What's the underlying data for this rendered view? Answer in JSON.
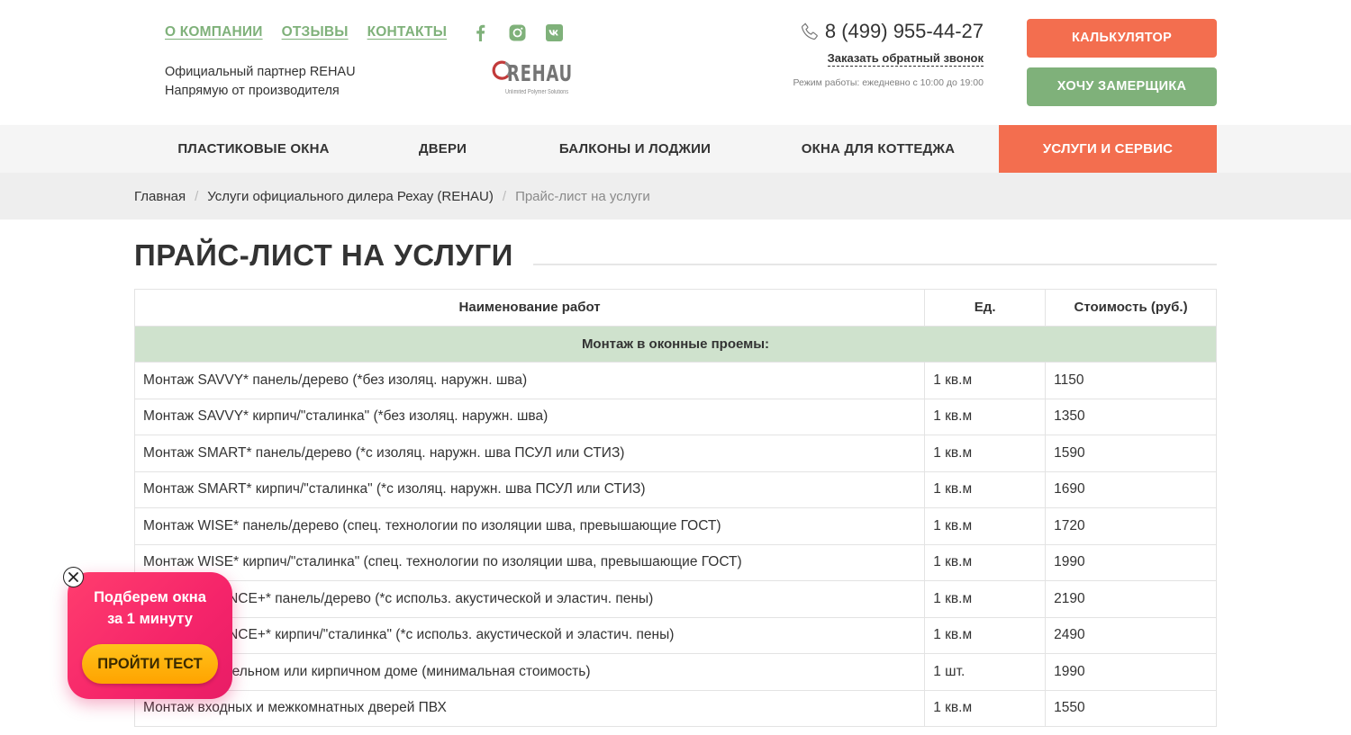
{
  "header": {
    "top_links": [
      "О КОМПАНИИ",
      "ОТЗЫВЫ",
      "КОНТАКТЫ"
    ],
    "social_icons": [
      "facebook-icon",
      "instagram-icon",
      "vk-icon"
    ],
    "partner_line1": "Официальный партнер REHAU",
    "partner_line2": "Напрямую от производителя",
    "logo_word": "REHAU",
    "logo_tagline": "Unlimited Polymer Solutions",
    "phone": "8 (499) 955-44-27",
    "callback": "Заказать обратный звонок",
    "hours": "Режим работы: ежедневно с 10:00 до 19:00",
    "btn_calc": "КАЛЬКУЛЯТОР",
    "btn_measure": "ХОЧУ ЗАМЕРЩИКА"
  },
  "colors": {
    "accent": "#f36e4f",
    "green": "#7fb17a",
    "group_row": "#cfe2cd",
    "promo": "#f5246a",
    "promo_button": "#ffb000"
  },
  "nav": [
    "ПЛАСТИКОВЫЕ ОКНА",
    "ДВЕРИ",
    "БАЛКОНЫ И ЛОДЖИИ",
    "ОКНА ДЛЯ КОТТЕДЖА",
    "УСЛУГИ И СЕРВИС"
  ],
  "breadcrumbs": {
    "home": "Главная",
    "section": "Услуги официального дилера Рехау (REHAU)",
    "current": "Прайс-лист на услуги",
    "separator": "/"
  },
  "page_title": "ПРАЙС-ЛИСТ НА УСЛУГИ",
  "table": {
    "headers": [
      "Наименование работ",
      "Ед.",
      "Стоимость (руб.)"
    ],
    "group": "Монтаж в оконные проемы:",
    "rows": [
      [
        "Монтаж SAVVY* панель/дерево (*без изоляц. наружн. шва)",
        "1 кв.м",
        "1150"
      ],
      [
        "Монтаж SAVVY* кирпич/\"сталинка\" (*без изоляц. наружн. шва)",
        "1 кв.м",
        "1350"
      ],
      [
        "Монтаж SMART* панель/дерево (*с изоляц. наружн. шва ПСУЛ или СТИЗ)",
        "1 кв.м",
        "1590"
      ],
      [
        "Монтаж SMART* кирпич/\"сталинка\" (*с изоляц. наружн. шва ПСУЛ или СТИЗ)",
        "1 кв.м",
        "1690"
      ],
      [
        "Монтаж WISE* панель/дерево (спец. технологии по изоляции шва, превышающие ГОСТ)",
        "1 кв.м",
        "1720"
      ],
      [
        "Монтаж WISE* кирпич/\"сталинка\" (спец. технологии по изоляции шва, превышающие ГОСТ)",
        "1 кв.м",
        "1990"
      ],
      [
        "Монтаж SILENCE+* панель/дерево (*с использ. акустической и эластич. пены)",
        "1 кв.м",
        "2190"
      ],
      [
        "Монтаж SILENCE+* кирпич/\"сталинка\" (*с использ. акустической и эластич. пены)",
        "1 кв.м",
        "2490"
      ],
      [
        "Монтаж в панельном или кирпичном доме (минимальная стоимость)",
        "1 шт.",
        "1990"
      ],
      [
        "Монтаж входных и межкомнатных дверей ПВХ",
        "1 кв.м",
        "1550"
      ]
    ]
  },
  "promo": {
    "line1": "Подберем окна",
    "line2": "за 1 минуту",
    "button": "ПРОЙТИ ТЕСТ",
    "close_icon": "close-icon"
  }
}
